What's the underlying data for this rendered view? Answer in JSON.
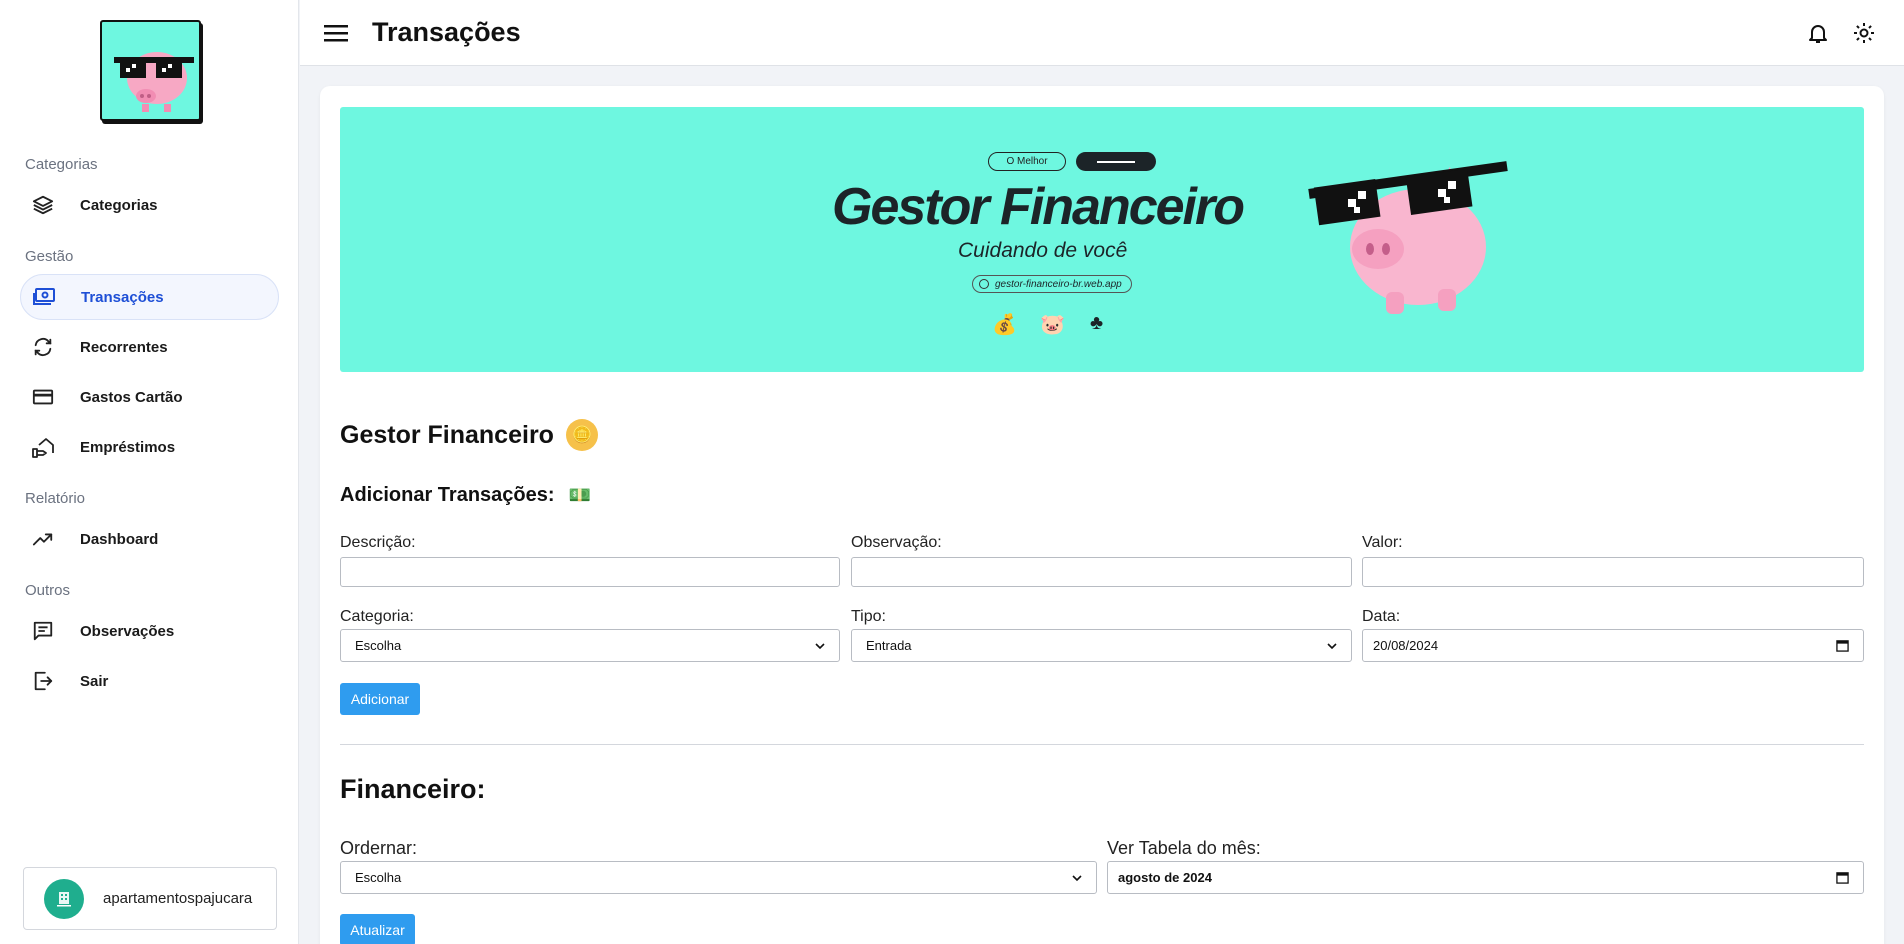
{
  "sidebar": {
    "sections": [
      {
        "title": "Categorias",
        "items": [
          {
            "label": "Categorias",
            "icon": "layers-icon"
          }
        ]
      },
      {
        "title": "Gestão",
        "items": [
          {
            "label": "Transações",
            "icon": "money-icon",
            "active": true
          },
          {
            "label": "Recorrentes",
            "icon": "refresh-icon"
          },
          {
            "label": "Gastos Cartão",
            "icon": "credit-card-icon"
          },
          {
            "label": "Empréstimos",
            "icon": "hand-house-icon"
          }
        ]
      },
      {
        "title": "Relatório",
        "items": [
          {
            "label": "Dashboard",
            "icon": "trend-up-icon"
          }
        ]
      },
      {
        "title": "Outros",
        "items": [
          {
            "label": "Observações",
            "icon": "comment-icon"
          },
          {
            "label": "Sair",
            "icon": "logout-icon"
          }
        ]
      }
    ],
    "user": {
      "name": "apartamentospajucara"
    }
  },
  "header": {
    "title": "Transações"
  },
  "banner": {
    "pill": "O Melhor",
    "title": "Gestor Financeiro",
    "subtitle": "Cuidando de você",
    "url": "gestor-financeiro-br.web.app",
    "icons": [
      "💰",
      "🐷",
      "♣"
    ]
  },
  "main": {
    "heading": "Gestor Financeiro",
    "heading_icon": "🪙",
    "add_heading": "Adicionar Transações:",
    "add_icon": "💵",
    "fields": {
      "descricao_label": "Descrição:",
      "observacao_label": "Observação:",
      "valor_label": "Valor:",
      "categoria_label": "Categoria:",
      "categoria_value": "Escolha",
      "tipo_label": "Tipo:",
      "tipo_value": "Entrada",
      "data_label": "Data:",
      "data_value": "20/08/2024"
    },
    "add_button": "Adicionar",
    "fin_heading": "Financeiro:",
    "ordenar_label": "Ordernar:",
    "ordenar_value": "Escolha",
    "mes_label": "Ver Tabela do mês:",
    "mes_value": "agosto de 2024",
    "update_button": "Atualizar"
  },
  "colors": {
    "accent": "#2f9cef",
    "banner": "#6ef7e0",
    "active_nav": "#1e4fd6"
  }
}
